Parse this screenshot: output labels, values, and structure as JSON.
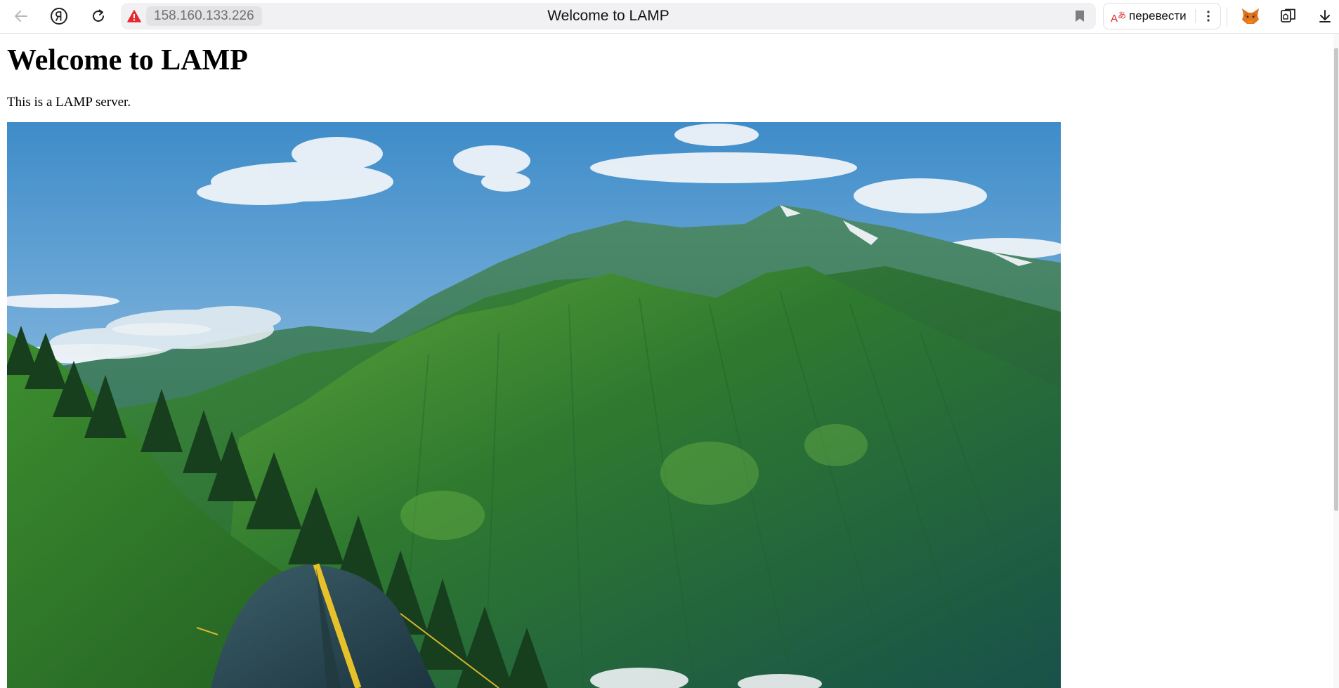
{
  "browser": {
    "url": "158.160.133.226",
    "tab_title": "Welcome to LAMP",
    "translate_label": "перевести",
    "icons": [
      "back-arrow-icon",
      "yandex-logo-icon",
      "reload-icon",
      "warning-icon",
      "bookmark-icon",
      "translate-icon",
      "more-vertical-icon",
      "metamask-fox-icon",
      "collections-icon",
      "download-icon"
    ],
    "accent_warning": "#e5292f"
  },
  "page": {
    "heading": "Welcome to LAMP",
    "description": "This is a LAMP server.",
    "image_subject": "mountain landscape with tent"
  }
}
